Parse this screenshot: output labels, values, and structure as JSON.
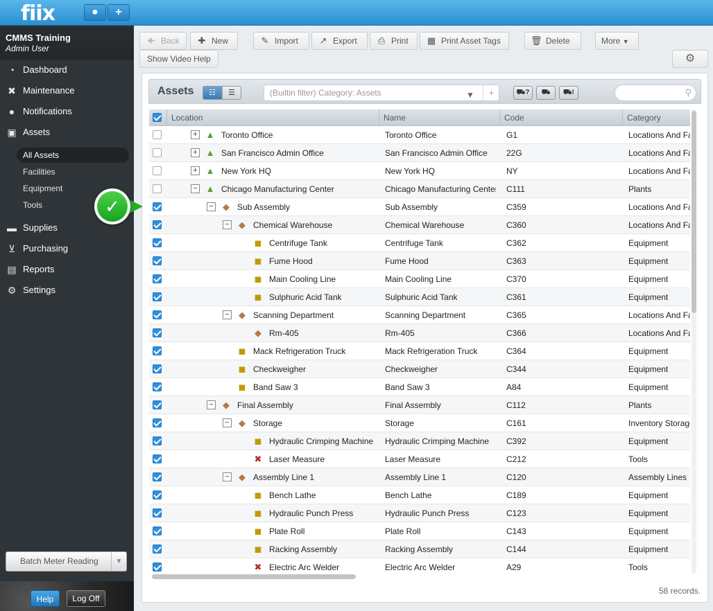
{
  "app": {
    "logo": "fiix"
  },
  "topbar": {
    "user_icon": "user-icon",
    "add_label": "+"
  },
  "org": {
    "name": "CMMS Training",
    "user": "Admin User"
  },
  "nav": [
    {
      "label": "Dashboard",
      "icon": "dashboard-icon",
      "glyph": "◔"
    },
    {
      "label": "Maintenance",
      "icon": "wrench-icon",
      "glyph": "✖"
    },
    {
      "label": "Notifications",
      "icon": "speech-bubble-icon",
      "glyph": "●"
    },
    {
      "label": "Assets",
      "icon": "boxes-icon",
      "glyph": "▣"
    },
    {
      "label": "Supplies",
      "icon": "truck-icon",
      "glyph": "▬"
    },
    {
      "label": "Purchasing",
      "icon": "cart-icon",
      "glyph": "⊻"
    },
    {
      "label": "Reports",
      "icon": "chart-icon",
      "glyph": "▤"
    },
    {
      "label": "Settings",
      "icon": "gear-icon",
      "glyph": "⚙"
    }
  ],
  "assets_sub": [
    {
      "label": "All Assets",
      "active": true
    },
    {
      "label": "Facilities"
    },
    {
      "label": "Equipment"
    },
    {
      "label": "Tools"
    }
  ],
  "sidebar_bottom": {
    "batch_label": "Batch Meter Reading",
    "help_label": "Help",
    "logoff_label": "Log Off"
  },
  "toolbar": {
    "back": "Back",
    "new": "New",
    "import": "Import",
    "export": "Export",
    "print": "Print",
    "print_tags": "Print Asset Tags",
    "delete": "Delete",
    "more": "More",
    "show_video_help": "Show Video Help"
  },
  "panel": {
    "title": "Assets",
    "filter_placeholder": "(Builtin filter) Category: Assets",
    "filter_plus": "+",
    "truck_buttons": [
      "?",
      "",
      "!"
    ],
    "records": "58 records."
  },
  "columns": {
    "location": "Location",
    "name": "Name",
    "code": "Code",
    "category": "Category"
  },
  "rows": [
    {
      "location": "Toronto Office",
      "name": "Toronto Office",
      "code": "G1",
      "category": "Locations And Facilities",
      "level": 0,
      "toggle": "+",
      "icon": "location-icon",
      "checked": false
    },
    {
      "location": "San Francisco Admin Office",
      "name": "San Francisco Admin Office",
      "code": "22G",
      "category": "Locations And Facilities",
      "level": 0,
      "toggle": "+",
      "icon": "location-icon",
      "checked": false
    },
    {
      "location": "New York HQ",
      "name": "New York HQ",
      "code": "NY",
      "category": "Locations And Facilities",
      "level": 0,
      "toggle": "+",
      "icon": "location-icon",
      "checked": false
    },
    {
      "location": "Chicago Manufacturing Center",
      "name": "Chicago Manufacturing Center",
      "code": "C111",
      "category": "Plants",
      "level": 0,
      "toggle": "−",
      "icon": "location-icon",
      "checked": false
    },
    {
      "location": "Sub Assembly",
      "name": "Sub Assembly",
      "code": "C359",
      "category": "Locations And Facilities",
      "level": 1,
      "toggle": "−",
      "icon": "box-icon",
      "checked": true
    },
    {
      "location": "Chemical Warehouse",
      "name": "Chemical Warehouse",
      "code": "C360",
      "category": "Locations And Facilities",
      "level": 2,
      "toggle": "−",
      "icon": "box-icon",
      "checked": true
    },
    {
      "location": "Centrifuge Tank",
      "name": "Centrifuge Tank",
      "code": "C362",
      "category": "Equipment",
      "level": 3,
      "toggle": "",
      "icon": "forklift-icon",
      "checked": true
    },
    {
      "location": "Fume Hood",
      "name": "Fume Hood",
      "code": "C363",
      "category": "Equipment",
      "level": 3,
      "toggle": "",
      "icon": "forklift-icon",
      "checked": true
    },
    {
      "location": "Main Cooling Line",
      "name": "Main Cooling Line",
      "code": "C370",
      "category": "Equipment",
      "level": 3,
      "toggle": "",
      "icon": "forklift-icon",
      "checked": true
    },
    {
      "location": "Sulphuric Acid Tank",
      "name": "Sulphuric Acid Tank",
      "code": "C361",
      "category": "Equipment",
      "level": 3,
      "toggle": "",
      "icon": "forklift-icon",
      "checked": true
    },
    {
      "location": "Scanning Department",
      "name": "Scanning Department",
      "code": "C365",
      "category": "Locations And Facilities",
      "level": 2,
      "toggle": "−",
      "icon": "box-icon",
      "checked": true
    },
    {
      "location": "Rm-405",
      "name": "Rm-405",
      "code": "C366",
      "category": "Locations And Facilities",
      "level": 3,
      "toggle": "",
      "icon": "box-icon",
      "checked": true
    },
    {
      "location": "Mack Refrigeration Truck",
      "name": "Mack Refrigeration Truck",
      "code": "C364",
      "category": "Equipment",
      "level": 2,
      "toggle": "",
      "icon": "forklift-icon",
      "checked": true
    },
    {
      "location": "Checkweigher",
      "name": "Checkweigher",
      "code": "C344",
      "category": "Equipment",
      "level": 2,
      "toggle": "",
      "icon": "forklift-icon",
      "checked": true
    },
    {
      "location": "Band Saw 3",
      "name": "Band Saw 3",
      "code": "A84",
      "category": "Equipment",
      "level": 2,
      "toggle": "",
      "icon": "forklift-icon",
      "checked": true
    },
    {
      "location": "Final Assembly",
      "name": "Final Assembly",
      "code": "C112",
      "category": "Plants",
      "level": 1,
      "toggle": "−",
      "icon": "box-icon",
      "checked": true
    },
    {
      "location": "Storage",
      "name": "Storage",
      "code": "C161",
      "category": "Inventory Storage",
      "level": 2,
      "toggle": "−",
      "icon": "box-icon",
      "checked": true
    },
    {
      "location": "Hydraulic Crimping Machine",
      "name": "Hydraulic Crimping Machine",
      "code": "C392",
      "category": "Equipment",
      "level": 3,
      "toggle": "",
      "icon": "forklift-icon",
      "checked": true
    },
    {
      "location": "Laser Measure",
      "name": "Laser Measure",
      "code": "C212",
      "category": "Tools",
      "level": 3,
      "toggle": "",
      "icon": "tools-icon",
      "checked": true
    },
    {
      "location": "Assembly Line 1",
      "name": "Assembly Line 1",
      "code": "C120",
      "category": "Assembly Lines",
      "level": 2,
      "toggle": "−",
      "icon": "box-icon",
      "checked": true
    },
    {
      "location": "Bench Lathe",
      "name": "Bench Lathe",
      "code": "C189",
      "category": "Equipment",
      "level": 3,
      "toggle": "",
      "icon": "forklift-icon",
      "checked": true
    },
    {
      "location": "Hydraulic Punch Press",
      "name": "Hydraulic Punch Press",
      "code": "C123",
      "category": "Equipment",
      "level": 3,
      "toggle": "",
      "icon": "forklift-icon",
      "checked": true
    },
    {
      "location": "Plate Roll",
      "name": "Plate Roll",
      "code": "C143",
      "category": "Equipment",
      "level": 3,
      "toggle": "",
      "icon": "forklift-icon",
      "checked": true
    },
    {
      "location": "Racking Assembly",
      "name": "Racking Assembly",
      "code": "C144",
      "category": "Equipment",
      "level": 3,
      "toggle": "",
      "icon": "forklift-icon",
      "checked": true
    },
    {
      "location": "Electric Arc Welder",
      "name": "Electric Arc Welder",
      "code": "A29",
      "category": "Tools",
      "level": 3,
      "toggle": "",
      "icon": "tools-icon",
      "checked": true
    }
  ],
  "colors": {
    "accent": "#2b8fd0",
    "check": "#2f8fe0",
    "callout": "#22ae26",
    "sidebar": "#2f3438"
  }
}
